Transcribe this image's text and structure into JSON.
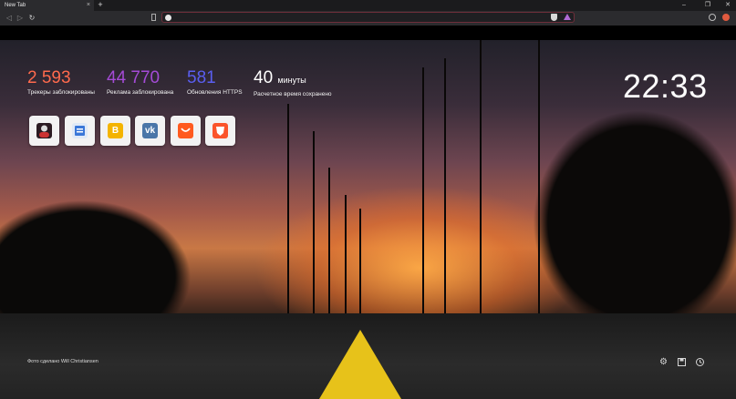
{
  "browser": {
    "tab_title": "New Tab",
    "tab_close": "×",
    "new_tab": "+",
    "win_min": "–",
    "win_max": "❐",
    "win_close": "✕",
    "back": "◁",
    "forward": "▷",
    "reload": "↻",
    "address": ""
  },
  "stats": [
    {
      "value": "2 593",
      "label": "Трекеры заблокированы",
      "color": "#ff6a4d"
    },
    {
      "value": "44 770",
      "label": "Реклама заблокирована",
      "color": "#a44bd6"
    },
    {
      "value": "581",
      "label": "Обновления HTTPS",
      "color": "#5a5ef0"
    },
    {
      "value": "40",
      "unit": "минуты",
      "label": "Расчетное время сохранено",
      "color": "#ffffff"
    }
  ],
  "clock": "22:33",
  "top_sites": [
    {
      "icon": "avatar-icon"
    },
    {
      "icon": "document-icon"
    },
    {
      "icon": "bitcoin-icon"
    },
    {
      "icon": "vk-icon",
      "text": "vk"
    },
    {
      "icon": "aliexpress-icon"
    },
    {
      "icon": "brave-icon"
    }
  ],
  "photo_credit": "Фото сделано Will Christiansen",
  "bottom_icons": [
    "settings-icon",
    "bookmarks-icon",
    "history-icon"
  ]
}
